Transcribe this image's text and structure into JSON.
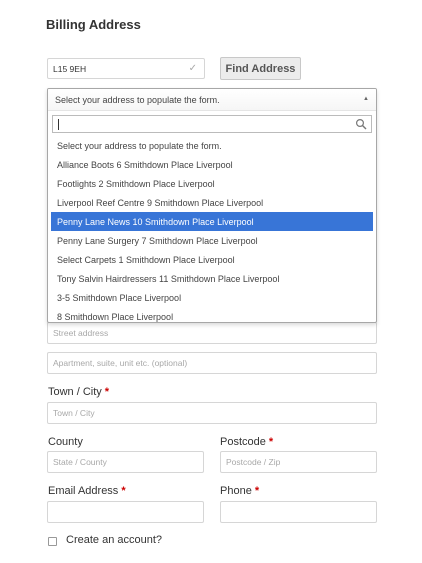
{
  "section_title": "Billing Address",
  "postcode_lookup": {
    "value": "L15 9EH",
    "check_icon": "checkmark-icon"
  },
  "find_address_label": "Find Address",
  "address_select": {
    "selected": "Select your address to populate the form.",
    "search_value": "",
    "options": [
      "Select your address to populate the form.",
      "Alliance Boots 6 Smithdown Place Liverpool",
      "Footlights 2 Smithdown Place Liverpool",
      "Liverpool Reef Centre 9 Smithdown Place Liverpool",
      "Penny Lane News 10 Smithdown Place Liverpool",
      "Penny Lane Surgery 7 Smithdown Place Liverpool",
      "Select Carpets 1 Smithdown Place Liverpool",
      "Tony Salvin Hairdressers 11 Smithdown Place Liverpool",
      "3-5 Smithdown Place Liverpool",
      "8 Smithdown Place Liverpool"
    ],
    "highlighted_index": 4,
    "highlight_color": "#3875d7"
  },
  "street_placeholder": "Street address",
  "apartment_placeholder": "Apartment, suite, unit etc. (optional)",
  "town": {
    "label": "Town / City",
    "placeholder": "Town / City"
  },
  "county": {
    "label": "County",
    "placeholder": "State / County"
  },
  "postcode": {
    "label": "Postcode",
    "placeholder": "Postcode / Zip"
  },
  "email": {
    "label": "Email Address",
    "value": ""
  },
  "phone": {
    "label": "Phone",
    "value": ""
  },
  "required_marker": "*",
  "required_color": "#cc0000",
  "create_account": {
    "label": "Create an account?",
    "checked": false
  }
}
